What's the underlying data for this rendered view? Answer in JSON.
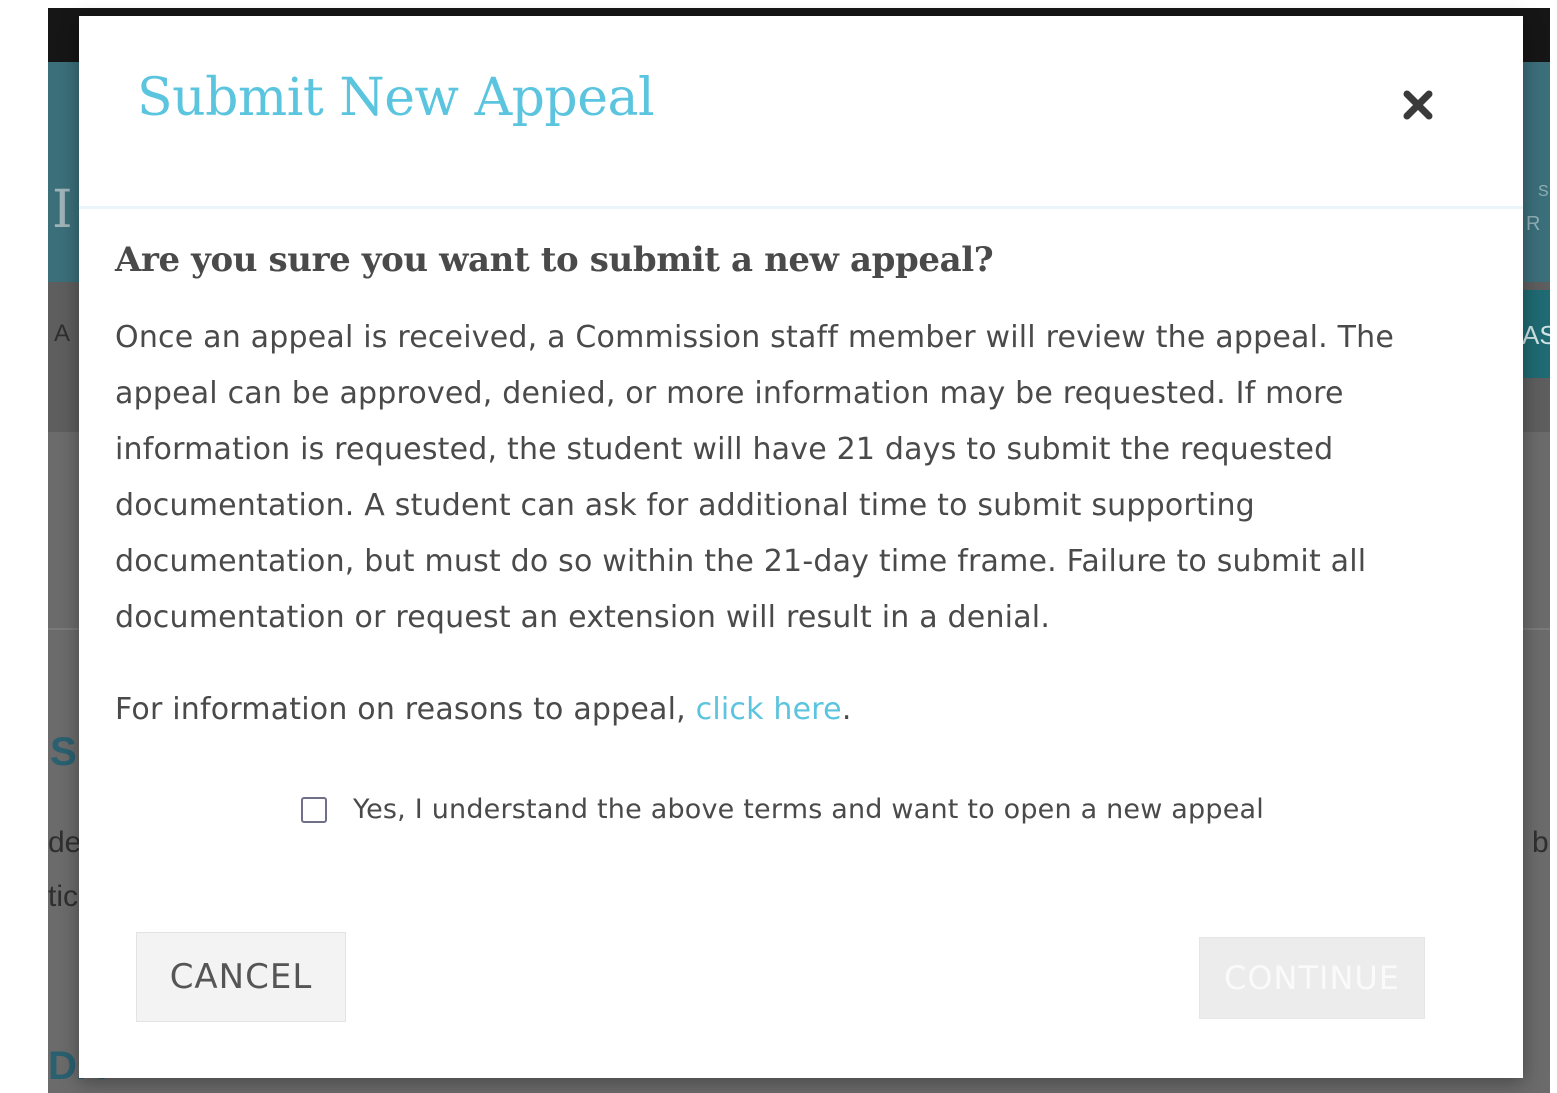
{
  "background_fragments": [
    "I",
    "A",
    "S",
    "de",
    "tic",
    "S",
    "R",
    "AS",
    "b",
    "DA"
  ],
  "modal": {
    "title": "Submit New Appeal",
    "close_icon": "close-icon",
    "question": "Are you sure you want to submit a new appeal?",
    "body": "Once an appeal is received, a Commission staff member will review the appeal. The appeal can be approved, denied, or more information may be requested. If more information is requested, the student will have 21 days to submit the requested documentation. A student can ask for additional time to submit supporting documentation, but must do so within the 21-day time frame. Failure to submit all documentation or request an extension will result in a denial.",
    "info_prefix": "For information on reasons to appeal, ",
    "info_link": "click here",
    "info_suffix": ".",
    "agree_label": "Yes, I understand the above terms and want to open a new appeal",
    "agree_checked": false,
    "cancel_label": "CANCEL",
    "continue_label": "CONTINUE",
    "continue_disabled": true
  },
  "colors": {
    "accent": "#5bc4de",
    "text": "#4a4a4a",
    "backdrop": "#6b6b6b"
  }
}
